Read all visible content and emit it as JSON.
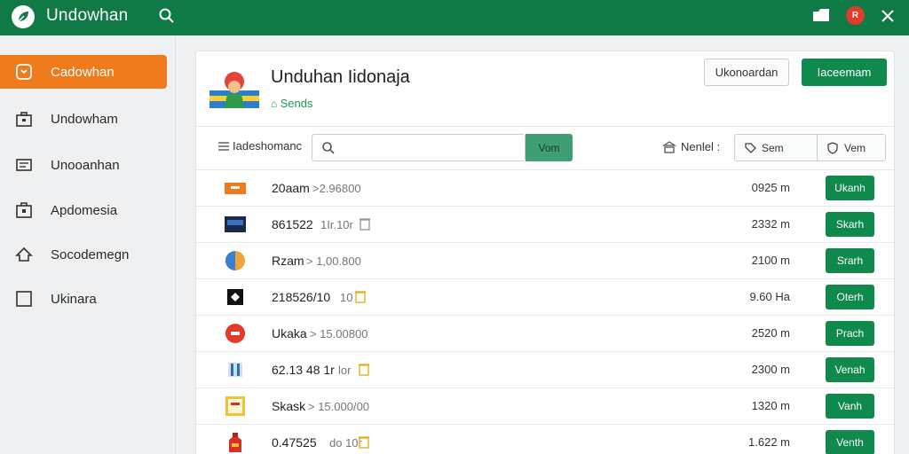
{
  "app": {
    "title": "Undowhan"
  },
  "sidebar": {
    "items": [
      {
        "label": "Cadowhan",
        "icon": "download-icon",
        "active": true
      },
      {
        "label": "Undowham",
        "icon": "briefcase-icon"
      },
      {
        "label": "Unooanhan",
        "icon": "list-icon"
      },
      {
        "label": "Apdomesia",
        "icon": "box-icon"
      },
      {
        "label": "Socodemegn",
        "icon": "home-icon"
      },
      {
        "label": "Ukinara",
        "icon": "square-icon"
      }
    ]
  },
  "header": {
    "title": "Unduhan Iidonaja",
    "subtitle": "Sends",
    "secondary_button": "Ukonoardan",
    "primary_button": "Iaceemam"
  },
  "filter": {
    "label": "Iadeshomanc",
    "search_placeholder": "",
    "search_button": "Vom",
    "sort_label": "Nenlel :",
    "seg1_label": "Sem",
    "seg2_label": "Vem"
  },
  "rows": [
    {
      "name": "20aam",
      "meta": ">2.96800",
      "size": "0925 m",
      "button": "Ukanh",
      "icon": "slide-orange-icon",
      "trash": false
    },
    {
      "name": "861522",
      "meta": "1Ir.10r",
      "size": "2332 m",
      "button": "Skarh",
      "icon": "card-dark-icon",
      "trash": true
    },
    {
      "name": "Rzam",
      "meta": ">  1,00.800",
      "size": "2100 m",
      "button": "Srarh",
      "icon": "pill-blue-icon",
      "trash": false
    },
    {
      "name": "218526/10",
      "meta": "10",
      "size": "9.60 Ha",
      "button": "Oterh",
      "icon": "black-box-icon",
      "trash": true
    },
    {
      "name": "Ukaka",
      "meta": "> 15.00800",
      "size": "2520 m",
      "button": "Prach",
      "icon": "red-circle-icon",
      "trash": false
    },
    {
      "name": "62.13 48 1r",
      "meta": "lor",
      "size": "2300 m",
      "button": "Venah",
      "icon": "blue-bars-icon",
      "trash": true
    },
    {
      "name": "Skask",
      "meta": "> 15.000/00",
      "size": "1320 m",
      "button": "Vanh",
      "icon": "yellow-frame-icon",
      "trash": false
    },
    {
      "name": "0.47525",
      "meta": "do  10r",
      "size": "1.622 m",
      "button": "Venth",
      "icon": "red-bottle-icon",
      "trash": true
    }
  ],
  "top_badge": "R",
  "colors": {
    "topbar": "#0f7a45",
    "accent_orange": "#f07b1c",
    "primary_green": "#0f8a4c"
  }
}
